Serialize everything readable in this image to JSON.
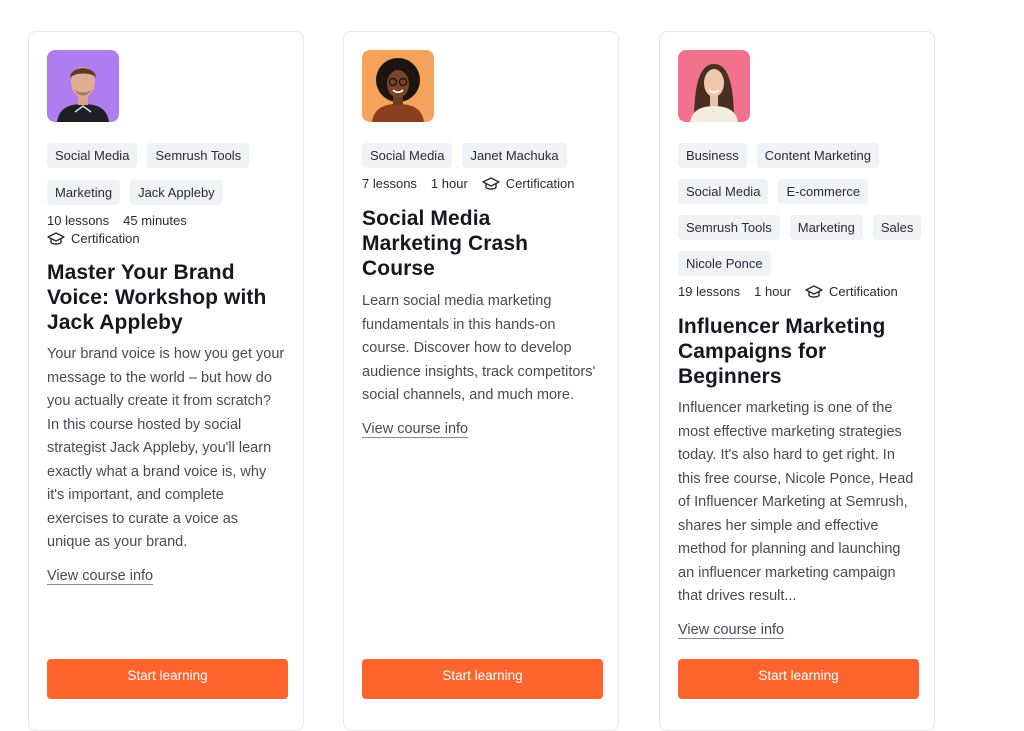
{
  "courses": [
    {
      "tags": [
        "Social Media",
        "Semrush Tools",
        "Marketing",
        "Jack Appleby"
      ],
      "lessons": "10 lessons",
      "duration": "45 minutes",
      "certification": "Certification",
      "title": "Master Your Brand Voice: Workshop with Jack Appleby",
      "description": "Your brand voice is how you get your message to the world – but how do you actually create it from scratch? In this course hosted by social strategist Jack Appleby, you'll learn exactly what a brand voice is, why it's important, and complete exercises to curate a voice as unique as your brand.",
      "link": "View course info",
      "button": "Start learning",
      "avatar_bg": "#b07df0"
    },
    {
      "tags": [
        "Social Media",
        "Janet Machuka"
      ],
      "lessons": "7 lessons",
      "duration": "1 hour",
      "certification": "Certification",
      "title": "Social Media Marketing Crash Course",
      "description": "Learn social media marketing fundamentals in this hands-on course. Discover how to develop audience insights, track competitors' social channels, and much more.",
      "link": "View course info",
      "button": "Start learning",
      "avatar_bg": "#f6a15c"
    },
    {
      "tags": [
        "Business",
        "Content Marketing",
        "Social Media",
        "E-commerce",
        "Semrush Tools",
        "Marketing",
        "Sales",
        "Nicole Ponce"
      ],
      "lessons": "19 lessons",
      "duration": "1 hour",
      "certification": "Certification",
      "title": "Influencer Marketing Campaigns for Beginners",
      "description": "Influencer marketing is one of the most effective marketing strategies today. It's also hard to get right. In this free course, Nicole Ponce, Head of Influencer Marketing at Semrush, shares her simple and effective method for planning and launching an influencer marketing campaign that drives result...",
      "link": "View course info",
      "button": "Start learning",
      "avatar_bg": "#f2728e"
    }
  ],
  "colors": {
    "accent": "#ff642d",
    "tag_bg": "#f1f2f6",
    "border": "#e7e7ee"
  }
}
